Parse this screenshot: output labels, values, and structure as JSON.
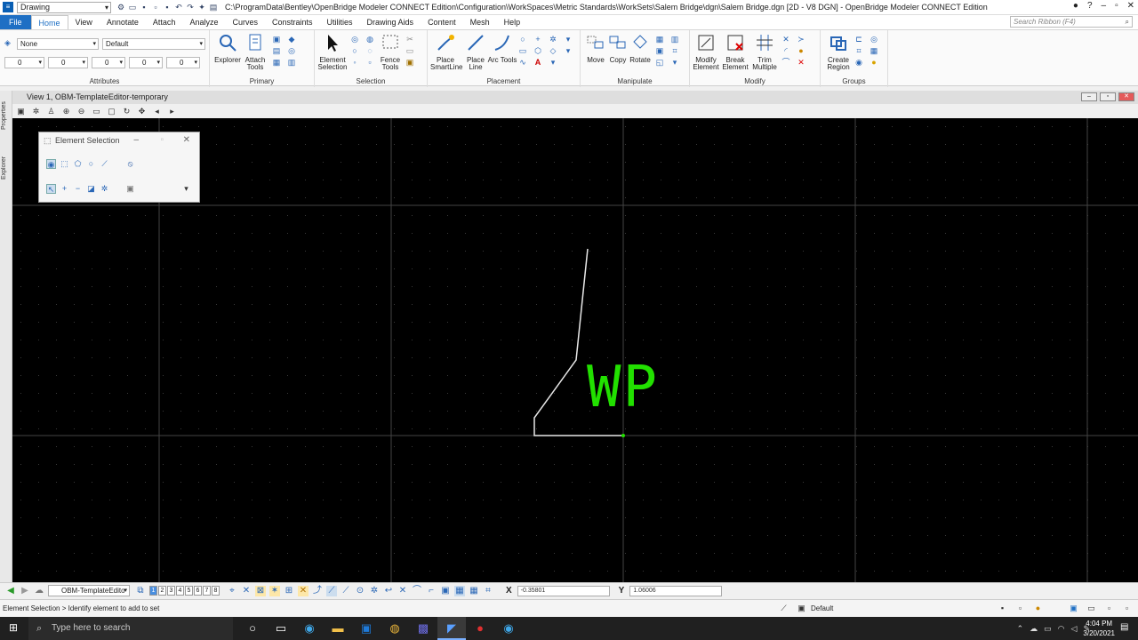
{
  "window": {
    "workflow": "Drawing",
    "title": "C:\\ProgramData\\Bentley\\OpenBridge Modeler CONNECT Edition\\Configuration\\WorkSpaces\\Metric Standards\\WorkSets\\Salem Bridge\\dgn\\Salem Bridge.dgn [2D - V8 DGN] - OpenBridge Modeler CONNECT Edition"
  },
  "ribbon": {
    "tabs": [
      "File",
      "Home",
      "View",
      "Annotate",
      "Attach",
      "Analyze",
      "Curves",
      "Constraints",
      "Utilities",
      "Drawing Aids",
      "Content",
      "Mesh",
      "Help"
    ],
    "active_tab": "Home",
    "search_placeholder": "Search Ribbon (F4)",
    "attributes": {
      "level": "None",
      "style": "Default",
      "color": "0",
      "weight": "0",
      "linestyle": "0",
      "transparency": "0",
      "priority": "0",
      "label": "Attributes"
    },
    "groups": {
      "primary": {
        "label": "Primary",
        "explorer": "Explorer",
        "attach_tools": "Attach Tools"
      },
      "selection": {
        "label": "Selection",
        "element_selection": "Element Selection",
        "fence_tools": "Fence Tools"
      },
      "placement": {
        "label": "Placement",
        "place_smartline": "Place SmartLine",
        "place_line": "Place Line",
        "arc_tools": "Arc Tools"
      },
      "manipulate": {
        "label": "Manipulate",
        "move": "Move",
        "copy": "Copy",
        "rotate": "Rotate"
      },
      "modify": {
        "label": "Modify",
        "modify_element": "Modify Element",
        "break_element": "Break Element",
        "trim_multiple": "Trim Multiple"
      },
      "groups": {
        "label": "Groups",
        "create_region": "Create Region"
      }
    }
  },
  "view": {
    "title": "View 1, OBM-TemplateEditor-temporary",
    "dock_tabs": [
      "Properties",
      "Explorer"
    ],
    "drawing_label": "WP",
    "line_color": "#e8e8e8",
    "label_color": "#22e000"
  },
  "dialog": {
    "title": "Element Selection"
  },
  "bottom": {
    "model": "OBM-TemplateEdito",
    "view_numbers": [
      "1",
      "2",
      "3",
      "4",
      "5",
      "6",
      "7",
      "8"
    ],
    "x_label": "X",
    "x_value": "-0.35801",
    "y_label": "Y",
    "y_value": "1.06006"
  },
  "status": {
    "prompt": "Element Selection > Identify element to add to set",
    "level": "Default"
  },
  "taskbar": {
    "search_placeholder": "Type here to search",
    "time": "4:04 PM",
    "date": "3/20/2021"
  }
}
